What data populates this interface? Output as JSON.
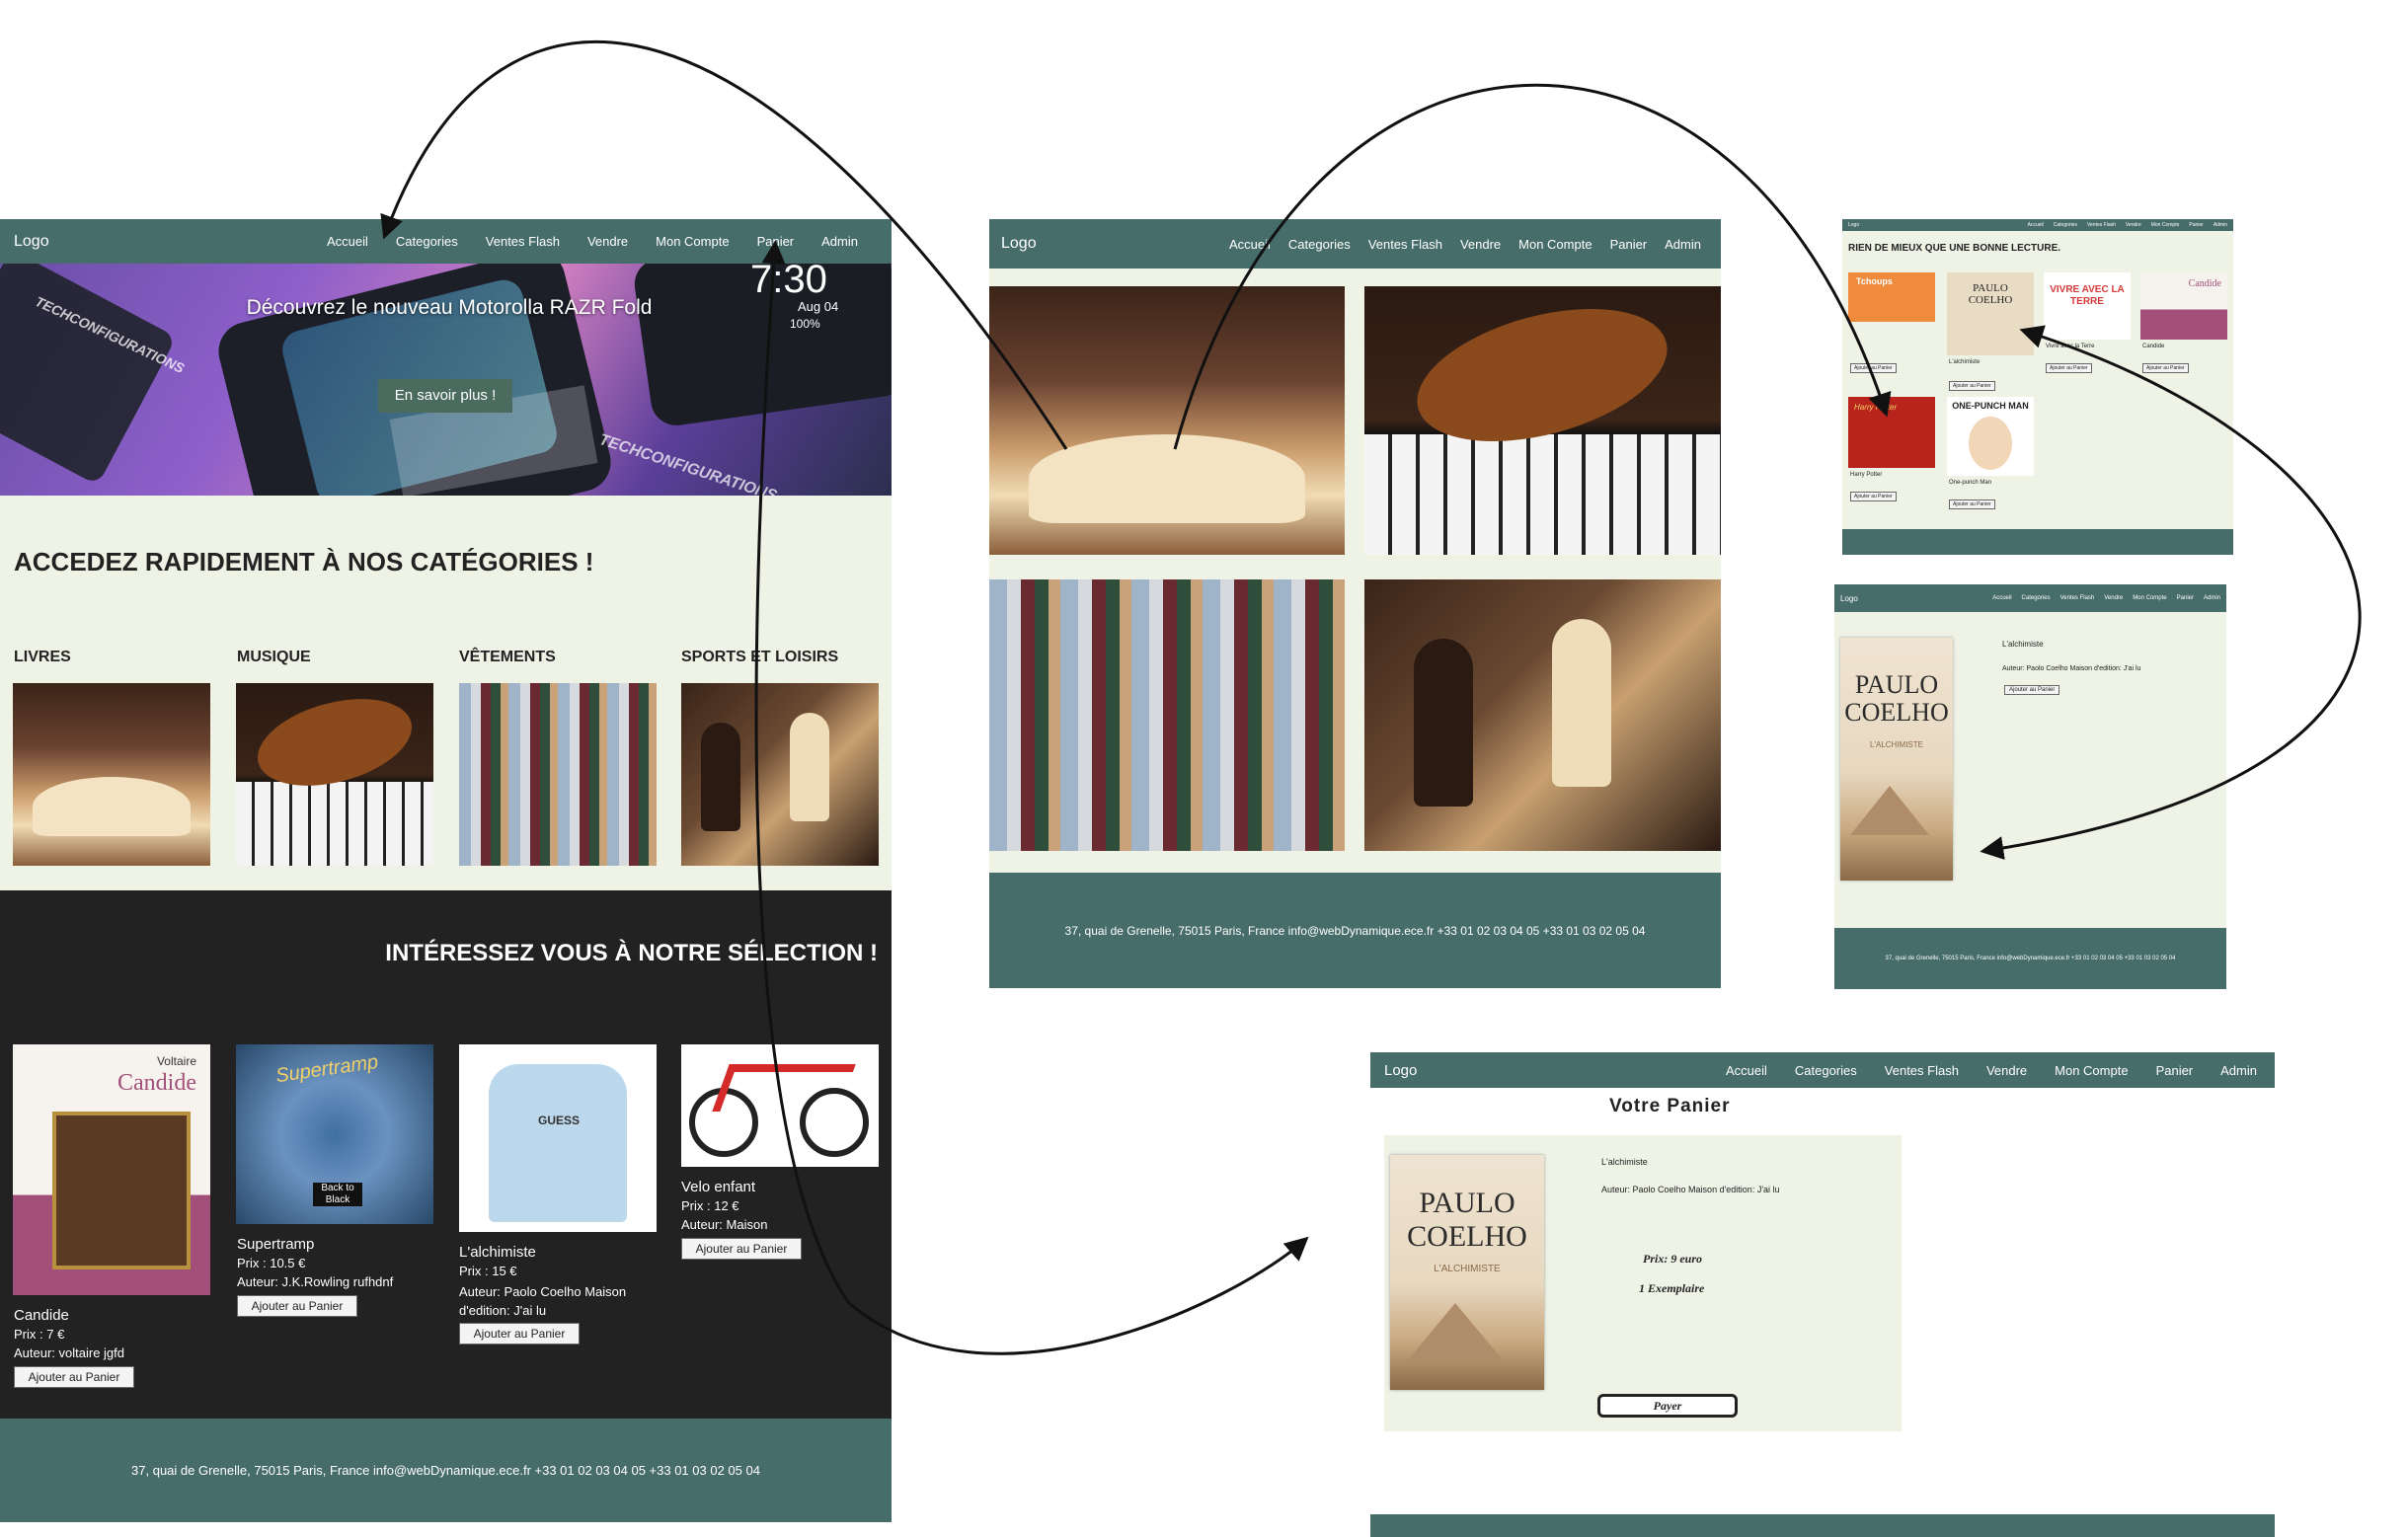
{
  "nav": {
    "logo": "Logo",
    "items": [
      "Accueil",
      "Categories",
      "Ventes Flash",
      "Vendre",
      "Mon Compte",
      "Panier",
      "Admin"
    ]
  },
  "home": {
    "hero": {
      "title": "Découvrez le nouveau Motorolla RAZR Fold",
      "button": "En savoir plus !",
      "watermark": "TECHCONFIGURATIONS",
      "phone_time": "7:30",
      "phone_date": "Aug 04",
      "phone_battery": "100%"
    },
    "categories_heading": "ACCEDEZ RAPIDEMENT À NOS CATÉGORIES !",
    "categories": [
      {
        "label": "LIVRES",
        "icon": "open-book-photo"
      },
      {
        "label": "MUSIQUE",
        "icon": "violin-piano-photo"
      },
      {
        "label": "VÊTEMENTS",
        "icon": "clothes-rack-photo"
      },
      {
        "label": "SPORTS ET LOISIRS",
        "icon": "chess-photo"
      }
    ],
    "selection_heading": "INTÉRESSEZ VOUS À NOTRE SÉLECTION !",
    "products": [
      {
        "name": "Candide",
        "price": "Prix : 7 €",
        "author": "Auteur: voltaire jgfd",
        "button": "Ajouter au Panier",
        "cover_author": "Voltaire",
        "cover_title": "Candide"
      },
      {
        "name": "Supertramp",
        "price": "Prix : 10.5 €",
        "author": "Auteur: J.K.Rowling rufhdnf",
        "button": "Ajouter au Panier",
        "cover_title": "Supertramp",
        "cover_badge": "Back to Black"
      },
      {
        "name": "L'alchimiste",
        "price": "Prix : 15 €",
        "author": "Auteur: Paolo Coelho Maison d'edition: J'ai lu",
        "button": "Ajouter au Panier",
        "cover_title": "GUESS"
      },
      {
        "name": "Velo enfant",
        "price": "Prix : 12 €",
        "author": "Auteur: Maison",
        "button": "Ajouter au Panier"
      }
    ],
    "footer": "37, quai de Grenelle, 75015 Paris, France info@webDynamique.ece.fr +33 01 02 03 04 05 +33 01 03 02 05 04"
  },
  "categories_page": {
    "footer": "37, quai de Grenelle, 75015 Paris, France info@webDynamique.ece.fr +33 01 02 03 04 05 +33 01 03 02 05 04"
  },
  "books_page": {
    "heading": "RIEN DE MIEUX QUE UNE BONNE LECTURE.",
    "books": [
      {
        "cover": "Tchoups",
        "title": "",
        "button": "Ajouter au Panier"
      },
      {
        "cover": "PAULO COELHO",
        "title": "L'alchimiste",
        "button": "Ajouter au Panier"
      },
      {
        "cover": "VIVRE AVEC LA TERRE",
        "title": "Vivre avec la Terre",
        "button": "Ajouter au Panier"
      },
      {
        "cover": "Candide",
        "title": "Candide",
        "button": "Ajouter au Panier"
      },
      {
        "cover": "Harry Potter",
        "title": "Harry Potter",
        "button": "Ajouter au Panier"
      },
      {
        "cover": "ONE-PUNCH MAN",
        "title": "One-punch Man",
        "button": "Ajouter au Panier"
      }
    ]
  },
  "detail_page": {
    "title": "L'alchimiste",
    "info": "Auteur: Paolo Coelho Maison d'edition: J'ai lu",
    "button": "Ajouter au Panier",
    "cover_author": "PAULO COELHO",
    "cover_subtitle": "L'ALCHIMISTE",
    "footer": "37, quai de Grenelle, 75015 Paris, France info@webDynamique.ece.fr +33 01 02 03 04 05 +33 01 03 02 05 04"
  },
  "cart_page": {
    "heading": "Votre Panier",
    "title": "L'alchimiste",
    "info": "Auteur: Paolo Coelho Maison d'edition: J'ai lu",
    "price": "Prix: 9 euro",
    "quantity": "1 Exemplaire",
    "pay_button": "Payer",
    "cover_author": "PAULO COELHO",
    "cover_subtitle": "L'ALCHIMISTE"
  },
  "colors": {
    "nav": "#466d6a",
    "cream": "#eef3e6",
    "dark": "#222222",
    "button": "#4a6b5e"
  }
}
